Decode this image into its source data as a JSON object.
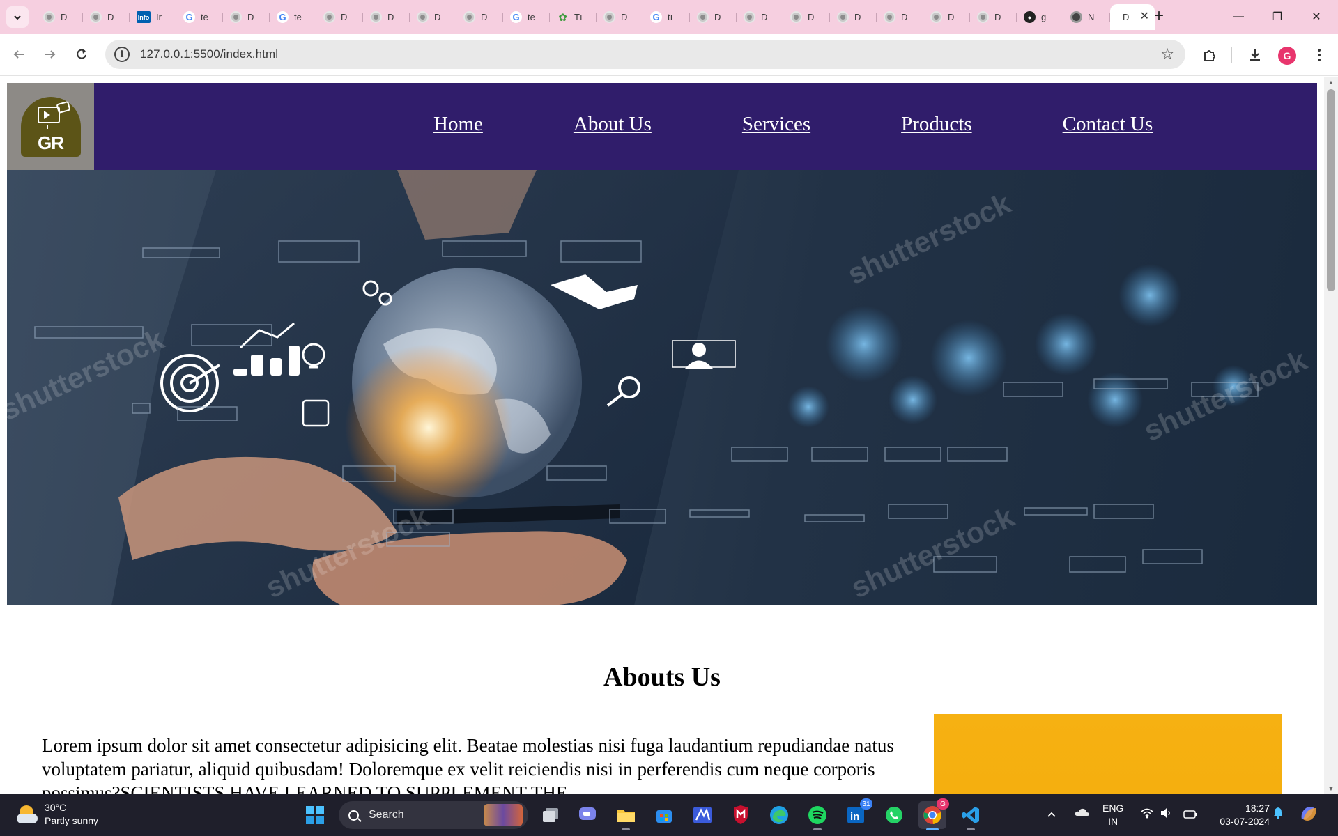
{
  "browser": {
    "tabs": [
      {
        "title": "D",
        "favicon": "generic"
      },
      {
        "title": "D",
        "favicon": "generic"
      },
      {
        "title": "Ir",
        "favicon": "infosys"
      },
      {
        "title": "te",
        "favicon": "google"
      },
      {
        "title": "D",
        "favicon": "generic"
      },
      {
        "title": "te",
        "favicon": "google"
      },
      {
        "title": "D",
        "favicon": "generic"
      },
      {
        "title": "D",
        "favicon": "generic"
      },
      {
        "title": "D",
        "favicon": "generic"
      },
      {
        "title": "D",
        "favicon": "generic"
      },
      {
        "title": "te",
        "favicon": "google"
      },
      {
        "title": "Tı",
        "favicon": "leaf"
      },
      {
        "title": "D",
        "favicon": "generic"
      },
      {
        "title": "tı",
        "favicon": "google"
      },
      {
        "title": "D",
        "favicon": "generic"
      },
      {
        "title": "D",
        "favicon": "generic"
      },
      {
        "title": "D",
        "favicon": "generic"
      },
      {
        "title": "D",
        "favicon": "generic"
      },
      {
        "title": "D",
        "favicon": "generic"
      },
      {
        "title": "D",
        "favicon": "generic"
      },
      {
        "title": "D",
        "favicon": "generic"
      },
      {
        "title": "g",
        "favicon": "github"
      },
      {
        "title": "N",
        "favicon": "chromeish"
      }
    ],
    "active_tab": {
      "title": "D",
      "close_icon": "close-icon"
    },
    "new_tab_label": "+",
    "window_controls": {
      "minimize": "—",
      "restore": "❐",
      "close": "✕"
    },
    "url": "127.0.0.1:5500/index.html",
    "profile_initial": "G"
  },
  "site": {
    "logo_text": "GR",
    "nav": [
      "Home",
      "About Us",
      "Services",
      "Products",
      "Contact Us"
    ],
    "hero_watermark": "shutterstock",
    "about": {
      "title": "Abouts Us",
      "paragraph": "Lorem ipsum dolor sit amet consectetur adipisicing elit. Beatae molestias nisi fuga laudantium repudiandae natus voluptatem pariatur, aliquid quibusdam! Doloremque ex velit reiciendis nisi in perferendis cum neque corporis possimus?SCIENTISTS HAVE LEARNED TO SUPPLEMENT THE"
    },
    "colors": {
      "header": "#301d6b",
      "logo_bg": "#8d8a86",
      "about_image": "#f6b112"
    }
  },
  "taskbar": {
    "weather": {
      "temp": "30°C",
      "condition": "Partly sunny"
    },
    "search_label": "Search",
    "apps": [
      "windows-start",
      "task-view",
      "teams-chat",
      "file-explorer",
      "microsoft-store",
      "app-icon",
      "mcafee",
      "edge",
      "spotify",
      "linkedin",
      "whatsapp",
      "chrome",
      "vs-code"
    ],
    "linkedin_badge": "31",
    "chrome_badge": "G",
    "language": {
      "line1": "ENG",
      "line2": "IN"
    },
    "time": "18:27",
    "date": "03-07-2024"
  }
}
